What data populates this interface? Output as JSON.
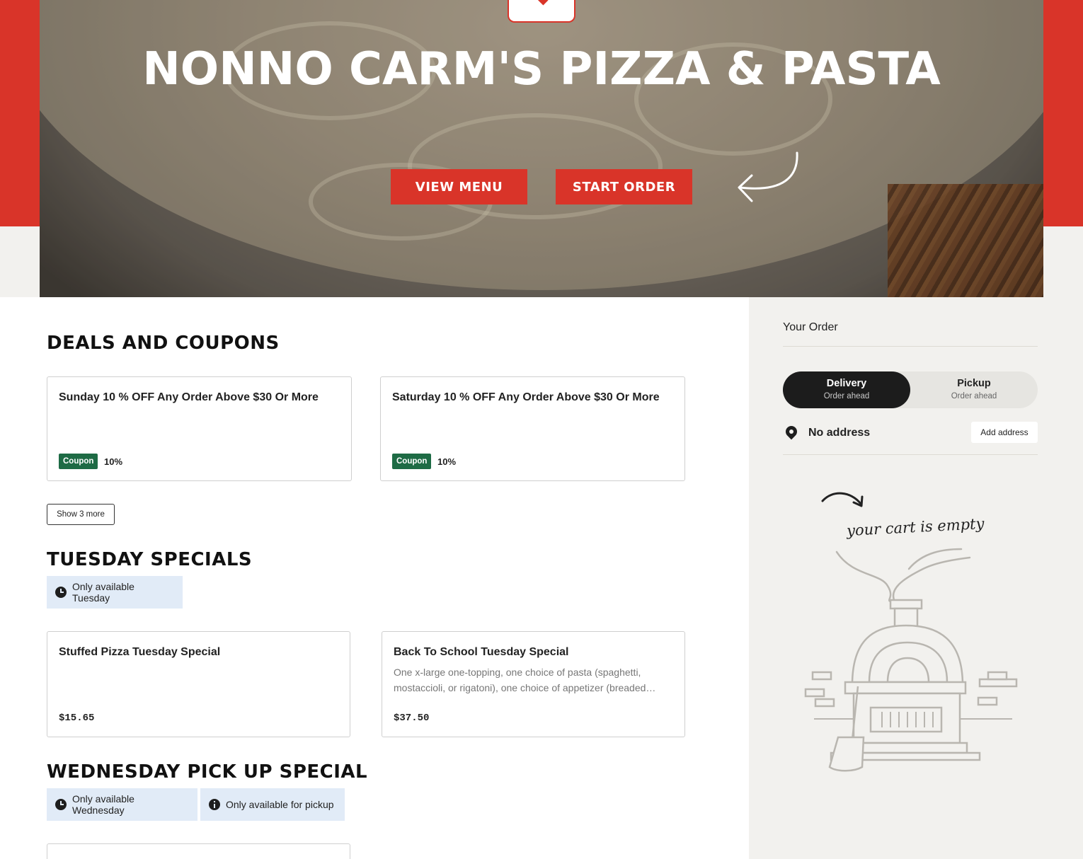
{
  "hero": {
    "title": "NONNO CARM'S PIZZA & PASTA",
    "view_menu_label": "VIEW MENU",
    "start_order_label": "START ORDER"
  },
  "deals": {
    "title": "DEALS AND COUPONS",
    "items": [
      {
        "title": "Sunday 10 % OFF Any Order Above $30 Or More",
        "badge": "Coupon",
        "value": "10%"
      },
      {
        "title": "Saturday 10 % OFF Any Order Above $30 Or More",
        "badge": "Coupon",
        "value": "10%"
      }
    ],
    "show_more_label": "Show 3 more"
  },
  "tuesday": {
    "title": "TUESDAY SPECIALS",
    "availability": "Only available Tuesday",
    "items": [
      {
        "title": "Stuffed Pizza Tuesday Special",
        "description": "",
        "price": "$15.65"
      },
      {
        "title": "Back To School Tuesday Special",
        "description": "One x-large one-topping, one choice of pasta (spaghetti, mostaccioli, or rigatoni), one choice of appetizer (breaded…",
        "price": "$37.50"
      }
    ]
  },
  "wednesday": {
    "title": "WEDNESDAY PICK UP SPECIAL",
    "chips": [
      "Only available Wednesday",
      "Only available for pickup"
    ]
  },
  "order": {
    "title": "Your Order",
    "delivery_label": "Delivery",
    "delivery_sub": "Order ahead",
    "pickup_label": "Pickup",
    "pickup_sub": "Order ahead",
    "address": "No address",
    "add_address_label": "Add address",
    "empty_cart": "your cart is empty",
    "selected_mode": "Delivery"
  },
  "colors": {
    "brand_red": "#d93429",
    "coupon_green": "#1e6b45",
    "chip_blue": "#e1ebf7",
    "sidebar_bg": "#f2f1ee"
  },
  "icons": [
    "clock-icon",
    "info-icon",
    "location-pin-icon",
    "arrow-icon",
    "pizza-oven-illustration"
  ]
}
